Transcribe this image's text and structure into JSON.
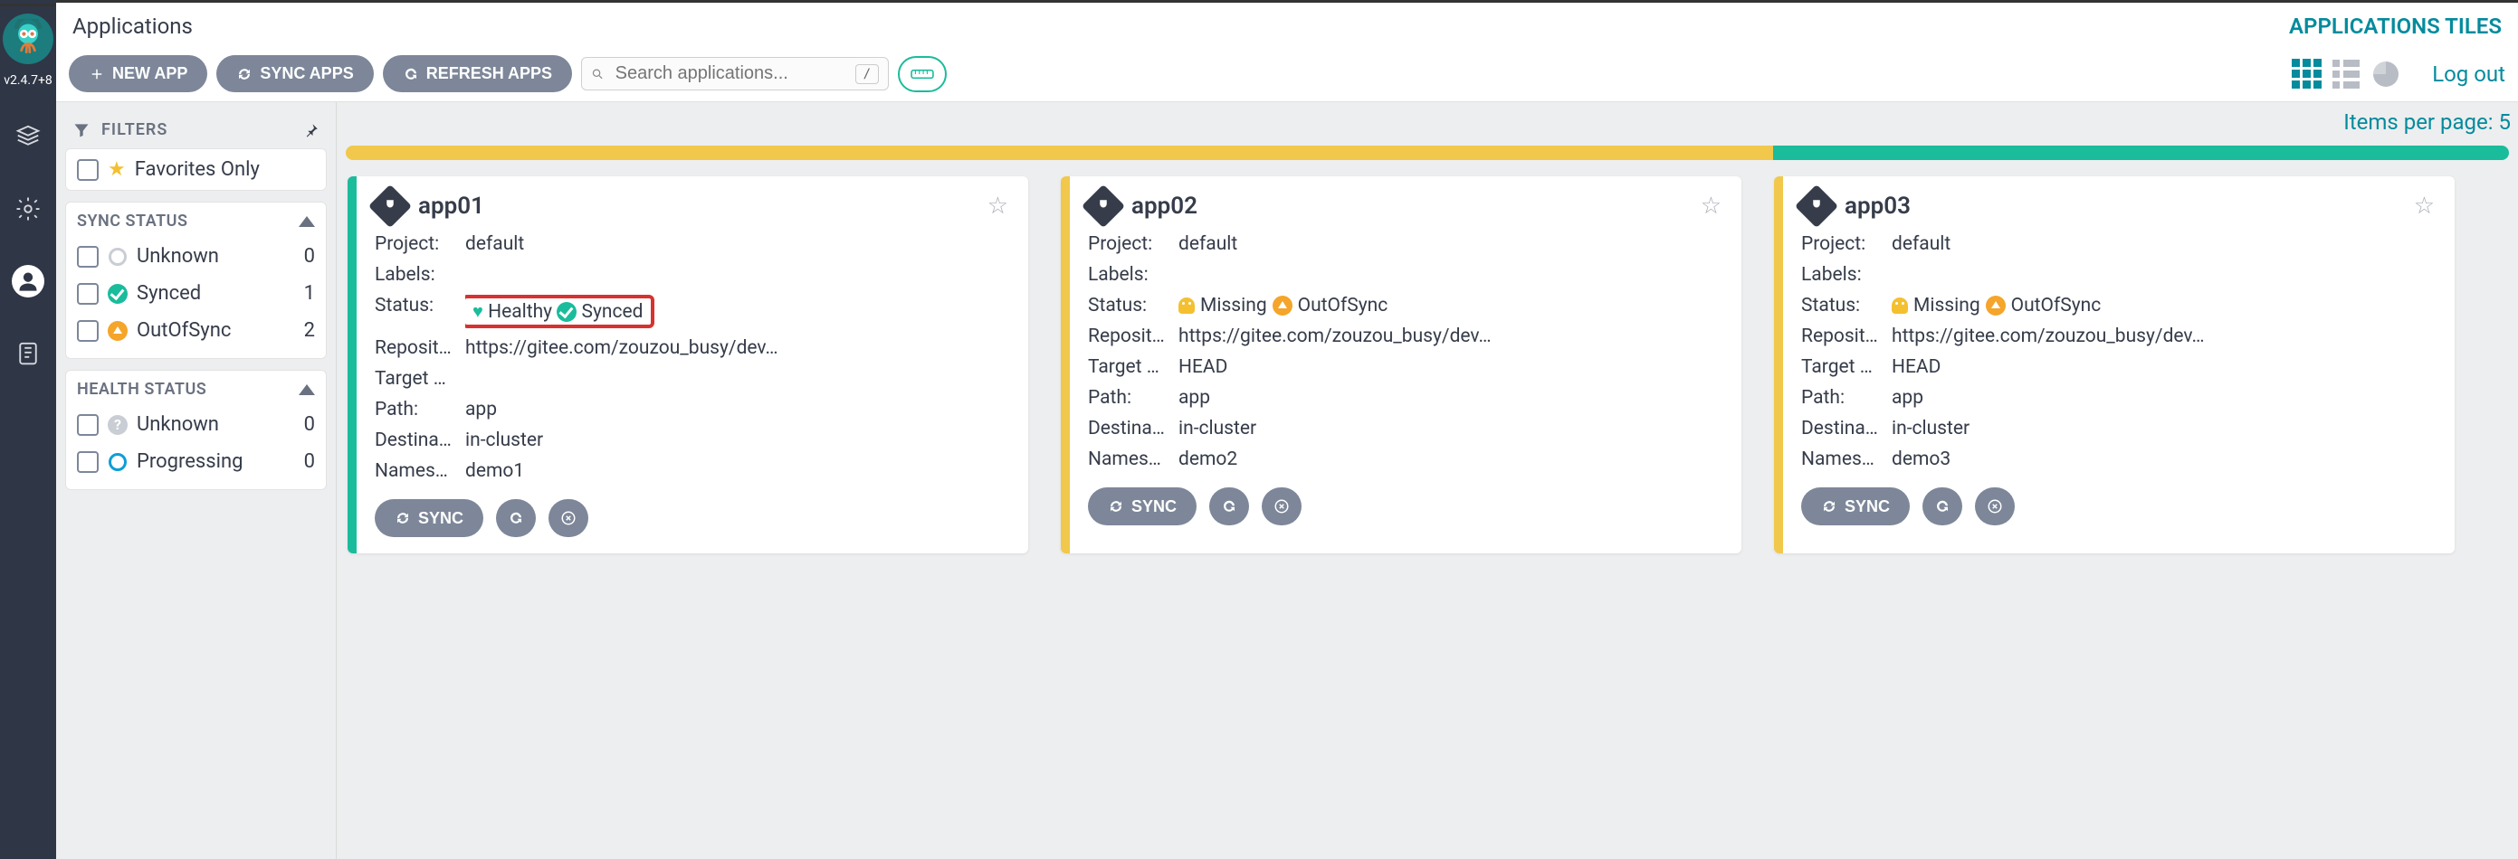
{
  "version": "v2.4.7+8",
  "header": {
    "title": "Applications",
    "right_label": "APPLICATIONS TILES"
  },
  "toolbar": {
    "new_app": "NEW APP",
    "sync_apps": "SYNC APPS",
    "refresh_apps": "REFRESH APPS",
    "search_placeholder": "Search applications...",
    "shortcut_key": "/",
    "logout": "Log out"
  },
  "filters": {
    "label": "FILTERS",
    "favorites_label": "Favorites Only",
    "sync_status_label": "SYNC STATUS",
    "sync_items": [
      {
        "label": "Unknown",
        "count": 0,
        "icon": "ring"
      },
      {
        "label": "Synced",
        "count": 1,
        "icon": "check"
      },
      {
        "label": "OutOfSync",
        "count": 2,
        "icon": "arrowup"
      }
    ],
    "health_status_label": "HEALTH STATUS",
    "health_items": [
      {
        "label": "Unknown",
        "count": 0,
        "icon": "q"
      },
      {
        "label": "Progressing",
        "count": 0,
        "icon": "ring-blue"
      }
    ]
  },
  "content": {
    "items_per_page": "Items per page: 5",
    "status_split_yellow_pct": 66,
    "status_split_green_pct": 34
  },
  "apps": [
    {
      "name": "app01",
      "border": "green",
      "project": "default",
      "labels": "",
      "status_health": "Healthy",
      "status_sync": "Synced",
      "status_style": "healthy",
      "repo": "https://gitee.com/zouzou_busy/dev…",
      "target": "",
      "path": "app",
      "destination": "in-cluster",
      "namespace": "demo1",
      "highlight_status": true
    },
    {
      "name": "app02",
      "border": "yellow",
      "project": "default",
      "labels": "",
      "status_health": "Missing",
      "status_sync": "OutOfSync",
      "status_style": "missing",
      "repo": "https://gitee.com/zouzou_busy/dev…",
      "target": "HEAD",
      "path": "app",
      "destination": "in-cluster",
      "namespace": "demo2",
      "highlight_status": false
    },
    {
      "name": "app03",
      "border": "yellow",
      "project": "default",
      "labels": "",
      "status_health": "Missing",
      "status_sync": "OutOfSync",
      "status_style": "missing",
      "repo": "https://gitee.com/zouzou_busy/dev…",
      "target": "HEAD",
      "path": "app",
      "destination": "in-cluster",
      "namespace": "demo3",
      "highlight_status": false
    }
  ],
  "kv_labels": {
    "project": "Project:",
    "labels": "Labels:",
    "status": "Status:",
    "repo": "Reposit…",
    "target": "Target …",
    "path": "Path:",
    "destination": "Destina…",
    "namespace": "Names…"
  },
  "actions": {
    "sync": "SYNC"
  }
}
